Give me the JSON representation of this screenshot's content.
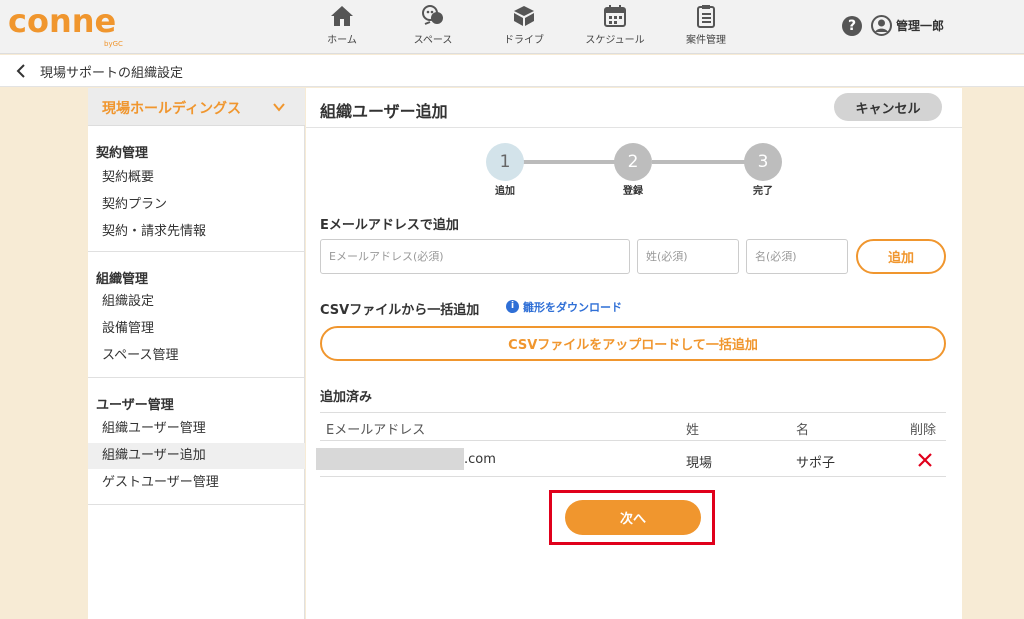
{
  "header": {
    "logo": "conne",
    "logo_sub": "byGC",
    "nav": [
      {
        "label": "ホーム",
        "icon": "home-icon"
      },
      {
        "label": "スペース",
        "icon": "space-icon"
      },
      {
        "label": "ドライブ",
        "icon": "drive-icon"
      },
      {
        "label": "スケジュール",
        "icon": "calendar-icon"
      },
      {
        "label": "案件管理",
        "icon": "clipboard-icon"
      }
    ],
    "help": "?",
    "user_name": "管理一郎"
  },
  "breadcrumb": {
    "title": "現場サポートの組織設定"
  },
  "sidebar": {
    "org_name": "現場ホールディングス",
    "groups": [
      {
        "heading": "契約管理",
        "items": [
          "契約概要",
          "契約プラン",
          "契約・請求先情報"
        ]
      },
      {
        "heading": "組織管理",
        "items": [
          "組織設定",
          "設備管理",
          "スペース管理"
        ]
      },
      {
        "heading": "ユーザー管理",
        "items": [
          "組織ユーザー管理",
          "組織ユーザー追加",
          "ゲストユーザー管理"
        ]
      }
    ],
    "active_item": "組織ユーザー追加"
  },
  "main": {
    "title": "組織ユーザー追加",
    "cancel_label": "キャンセル",
    "steps": [
      {
        "number": "1",
        "label": "追加"
      },
      {
        "number": "2",
        "label": "登録"
      },
      {
        "number": "3",
        "label": "完了"
      }
    ],
    "email_section": "Eメールアドレスで追加",
    "email_placeholder": "Eメールアドレス(必須)",
    "last_name_placeholder": "姓(必須)",
    "first_name_placeholder": "名(必須)",
    "add_label": "追加",
    "csv_section": "CSVファイルから一括追加",
    "info_icon": "i",
    "template_link": "雛形をダウンロード",
    "csv_button": "CSVファイルをアップロードして一括追加",
    "added_section": "追加済み",
    "table": {
      "columns": [
        "Eメールアドレス",
        "姓",
        "名",
        "削除"
      ],
      "rows": [
        {
          "email": ".com",
          "last_name": "現場",
          "first_name": "サポ子"
        }
      ]
    },
    "next_label": "次へ"
  },
  "colors": {
    "accent": "#f0962e",
    "danger": "#e0001b",
    "link": "#2f6fd6"
  }
}
